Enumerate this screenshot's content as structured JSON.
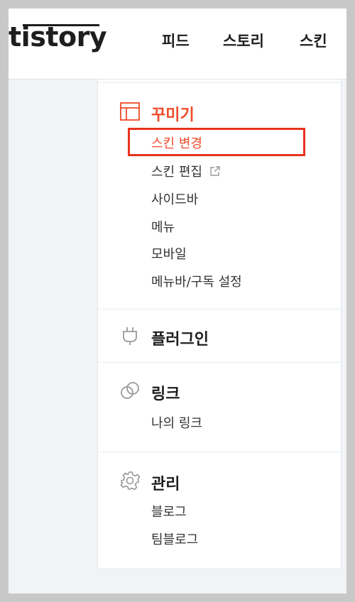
{
  "header": {
    "logo": "tistory",
    "nav": [
      "피드",
      "스토리",
      "스킨"
    ]
  },
  "sidebar": {
    "sections": [
      {
        "title": "꾸미기",
        "icon": "layout-icon",
        "active": true,
        "items": [
          "스킨 변경",
          "스킨 편집",
          "사이드바",
          "메뉴",
          "모바일",
          "메뉴바/구독 설정"
        ],
        "active_item": "스킨 변경"
      },
      {
        "title": "플러그인",
        "icon": "plug-icon",
        "items": []
      },
      {
        "title": "링크",
        "icon": "link-icon",
        "items": [
          "나의 링크"
        ]
      },
      {
        "title": "관리",
        "icon": "gear-icon",
        "items": [
          "블로그",
          "팀블로그"
        ]
      }
    ]
  },
  "colors": {
    "accent": "#ef4a2a",
    "highlight_border": "#e8341c"
  }
}
